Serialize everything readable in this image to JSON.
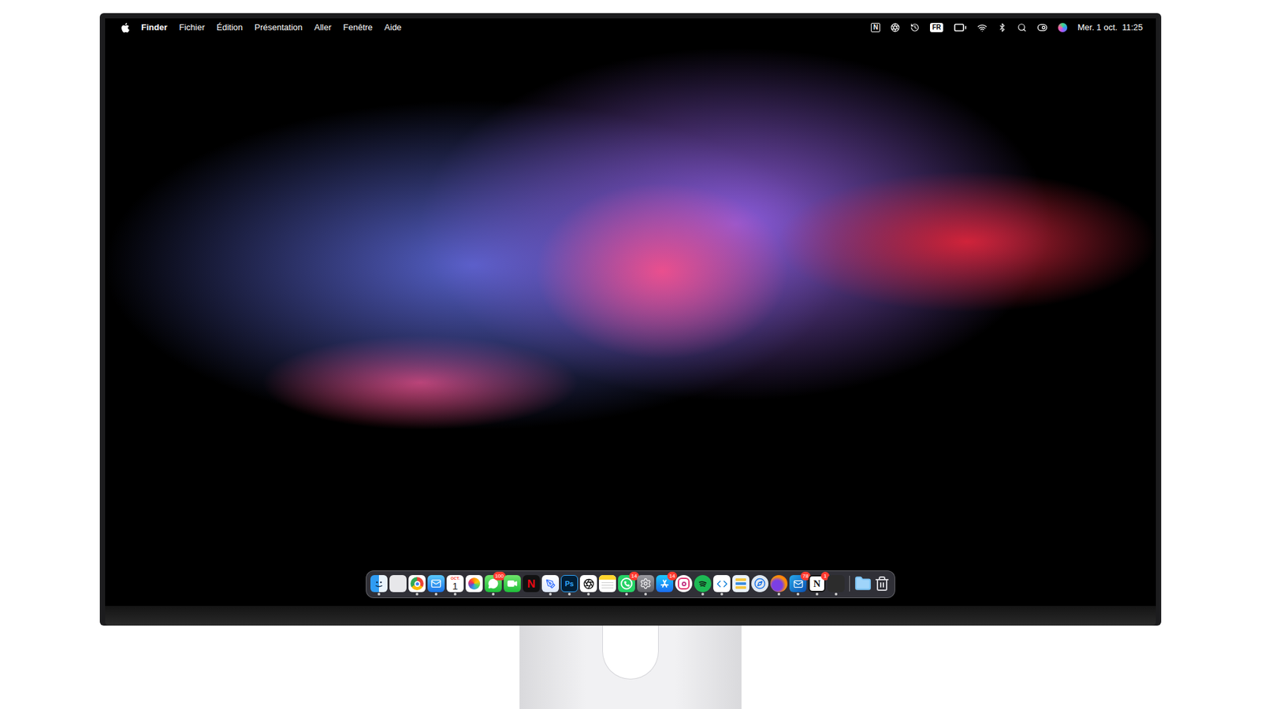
{
  "menu_bar": {
    "app": "Finder",
    "menus": [
      "Fichier",
      "Édition",
      "Présentation",
      "Aller",
      "Fenêtre",
      "Aide"
    ],
    "notion_extra": "N",
    "input_source": "FR",
    "date": "Mer. 1 oct.",
    "time": "11:25"
  },
  "dock": {
    "apps": [
      {
        "kind": "finder",
        "running": true,
        "badge": "",
        "label": "",
        "sublabel": ""
      },
      {
        "kind": "launchpad",
        "running": false,
        "badge": "",
        "label": "",
        "sublabel": ""
      },
      {
        "kind": "chrome",
        "running": true,
        "badge": "",
        "label": "",
        "sublabel": ""
      },
      {
        "kind": "mail",
        "running": true,
        "badge": "",
        "label": "",
        "sublabel": ""
      },
      {
        "kind": "calendar",
        "running": true,
        "badge": "",
        "label": "1",
        "sublabel": "OCT."
      },
      {
        "kind": "photos",
        "running": false,
        "badge": "",
        "label": "",
        "sublabel": ""
      },
      {
        "kind": "messages",
        "running": true,
        "badge": "100",
        "label": "",
        "sublabel": ""
      },
      {
        "kind": "facetime",
        "running": false,
        "badge": "",
        "label": "",
        "sublabel": ""
      },
      {
        "kind": "netflix",
        "running": false,
        "badge": "",
        "label": "N",
        "sublabel": ""
      },
      {
        "kind": "vectornator",
        "running": true,
        "badge": "",
        "label": "",
        "sublabel": ""
      },
      {
        "kind": "photoshop",
        "running": true,
        "badge": "",
        "label": "Ps",
        "sublabel": ""
      },
      {
        "kind": "chatgpt",
        "running": true,
        "badge": "",
        "label": "",
        "sublabel": ""
      },
      {
        "kind": "notes",
        "running": false,
        "badge": "",
        "label": "",
        "sublabel": ""
      },
      {
        "kind": "whatsapp",
        "running": true,
        "badge": "14",
        "label": "",
        "sublabel": ""
      },
      {
        "kind": "settings",
        "running": true,
        "badge": "",
        "label": "",
        "sublabel": ""
      },
      {
        "kind": "appstore",
        "running": false,
        "badge": "14",
        "label": "",
        "sublabel": ""
      },
      {
        "kind": "instagram",
        "running": false,
        "badge": "",
        "label": "",
        "sublabel": ""
      },
      {
        "kind": "spotify",
        "running": true,
        "badge": "",
        "label": "",
        "sublabel": ""
      },
      {
        "kind": "vscode",
        "running": true,
        "badge": "",
        "label": "",
        "sublabel": ""
      },
      {
        "kind": "keka",
        "running": false,
        "badge": "",
        "label": "",
        "sublabel": ""
      },
      {
        "kind": "safari",
        "running": false,
        "badge": "",
        "label": "",
        "sublabel": ""
      },
      {
        "kind": "firefox",
        "running": true,
        "badge": "",
        "label": "",
        "sublabel": ""
      },
      {
        "kind": "outlook",
        "running": true,
        "badge": "78",
        "label": "",
        "sublabel": ""
      },
      {
        "kind": "notion",
        "running": true,
        "badge": "1",
        "label": "N",
        "sublabel": ""
      },
      {
        "kind": "figma",
        "running": true,
        "badge": "",
        "label": "",
        "sublabel": ""
      }
    ],
    "stacks": [
      {
        "kind": "downloads",
        "running": false,
        "badge": "",
        "label": "",
        "sublabel": ""
      },
      {
        "kind": "trash",
        "running": false,
        "badge": "",
        "label": "",
        "sublabel": ""
      }
    ]
  }
}
